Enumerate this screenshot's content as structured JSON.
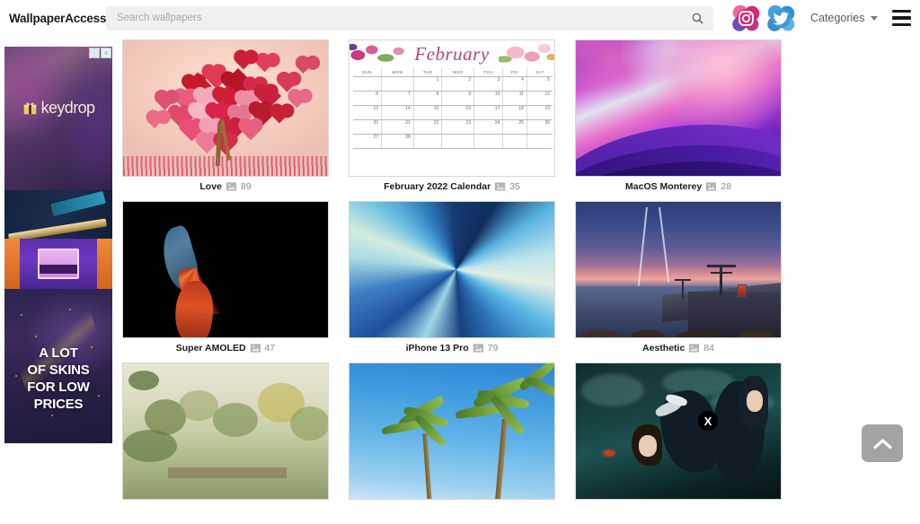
{
  "header": {
    "brand": "WallpaperAccess",
    "search": {
      "placeholder": "Search wallpapers",
      "value": "",
      "button_icon": "search-icon"
    },
    "social": [
      {
        "name": "instagram",
        "label": "Instagram"
      },
      {
        "name": "twitter",
        "label": "Twitter"
      }
    ],
    "categories_label": "Categories",
    "menu_icon": "hamburger-icon"
  },
  "ad": {
    "brand": "keydrop",
    "headline": "A LOT\nOF SKINS\nFOR LOW\nPRICES",
    "headline_lines": [
      "A LOT",
      "OF SKINS",
      "FOR LOW",
      "PRICES"
    ],
    "info_badge": "ⓘ",
    "close_badge": "×"
  },
  "grid": {
    "rows": [
      [
        {
          "title": "Love",
          "count": "89",
          "icon": "image-icon"
        },
        {
          "title": "February 2022 Calendar",
          "count": "35",
          "icon": "image-icon"
        },
        {
          "title": "MacOS Monterey",
          "count": "28",
          "icon": "image-icon"
        }
      ],
      [
        {
          "title": "Super AMOLED",
          "count": "47",
          "icon": "image-icon"
        },
        {
          "title": "iPhone 13 Pro",
          "count": "79",
          "icon": "image-icon"
        },
        {
          "title": "Aesthetic",
          "count": "84",
          "icon": "image-icon"
        }
      ],
      [
        {
          "title": "",
          "count": "",
          "icon": "image-icon"
        },
        {
          "title": "",
          "count": "",
          "icon": "image-icon"
        },
        {
          "title": "",
          "count": "",
          "icon": "image-icon"
        }
      ]
    ]
  },
  "calendar": {
    "month_title": "February",
    "weekdays": [
      "SUN",
      "MON",
      "TUE",
      "WED",
      "THU",
      "FRI",
      "SAT"
    ],
    "weeks": [
      [
        "",
        "",
        "1",
        "2",
        "3",
        "4",
        "5"
      ],
      [
        "6",
        "7",
        "8",
        "9",
        "10",
        "11",
        "12"
      ],
      [
        "13",
        "14",
        "15",
        "16",
        "17",
        "18",
        "19"
      ],
      [
        "20",
        "21",
        "22",
        "23",
        "24",
        "25",
        "26"
      ],
      [
        "27",
        "28",
        "",
        "",
        "",
        "",
        ""
      ]
    ]
  },
  "overlay": {
    "anime_close_label": "X"
  },
  "scroll_top": {
    "icon": "chevron-up-icon"
  },
  "colors": {
    "page_bg": "#ffffff",
    "search_bg": "#f0f0f0",
    "text_dark": "#1b1b1b",
    "text_muted": "#8c8c8c",
    "scroll_top_bg": "#a3a3a3"
  }
}
